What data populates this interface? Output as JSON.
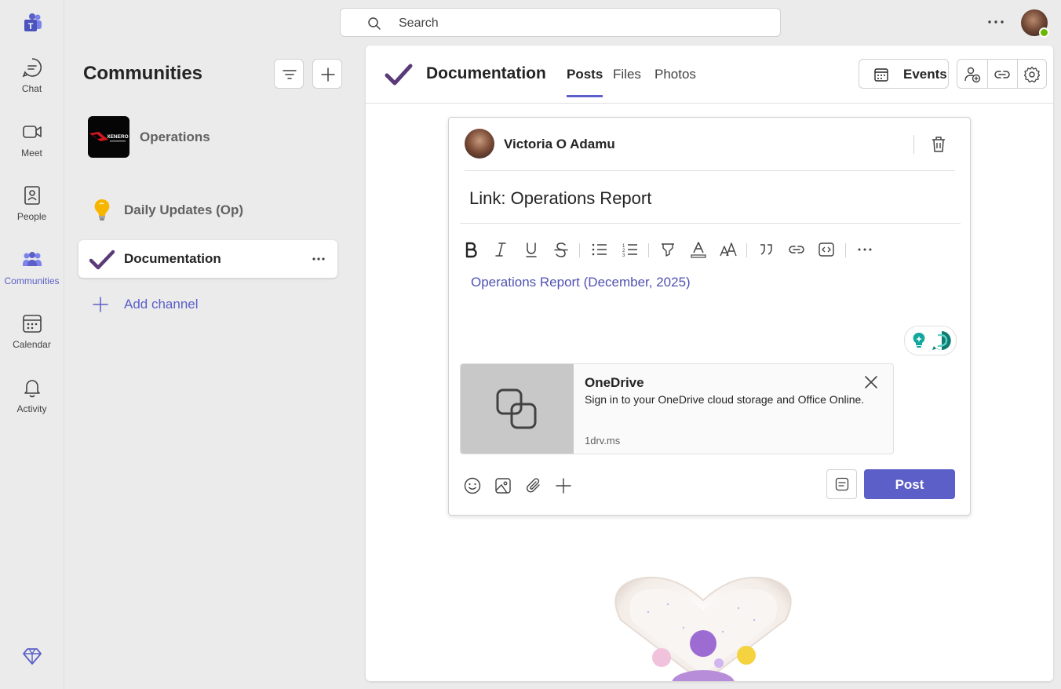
{
  "rail": {
    "items": [
      {
        "label": "Chat",
        "icon": "chat-icon"
      },
      {
        "label": "Meet",
        "icon": "video-icon"
      },
      {
        "label": "People",
        "icon": "people-icon"
      },
      {
        "label": "Communities",
        "icon": "communities-icon",
        "active": true
      },
      {
        "label": "Calendar",
        "icon": "calendar-icon"
      },
      {
        "label": "Activity",
        "icon": "bell-icon"
      }
    ]
  },
  "search": {
    "placeholder": "Search"
  },
  "sidebar": {
    "title": "Communities",
    "team": {
      "name": "Operations",
      "logo_text": "XENERO"
    },
    "channels": [
      {
        "label": "Daily Updates (Op)",
        "icon": "lightbulb-icon"
      },
      {
        "label": "Documentation",
        "icon": "checkmark-icon",
        "active": true
      }
    ],
    "add_channel": "Add channel"
  },
  "header": {
    "title": "Documentation",
    "tabs": [
      {
        "label": "Posts",
        "active": true
      },
      {
        "label": "Files"
      },
      {
        "label": "Photos"
      }
    ],
    "events_label": "Events"
  },
  "compose": {
    "author": "Victoria O Adamu",
    "subject": "Link: Operations Report",
    "link_text": "Operations Report (December, 2025)",
    "preview": {
      "title": "OneDrive",
      "description": "Sign in to your OneDrive cloud storage and Office Online.",
      "url": "1drv.ms"
    },
    "post_label": "Post"
  },
  "colors": {
    "accent": "#5b5fc7",
    "link": "#4f52b2",
    "presence": "#6bb700"
  }
}
